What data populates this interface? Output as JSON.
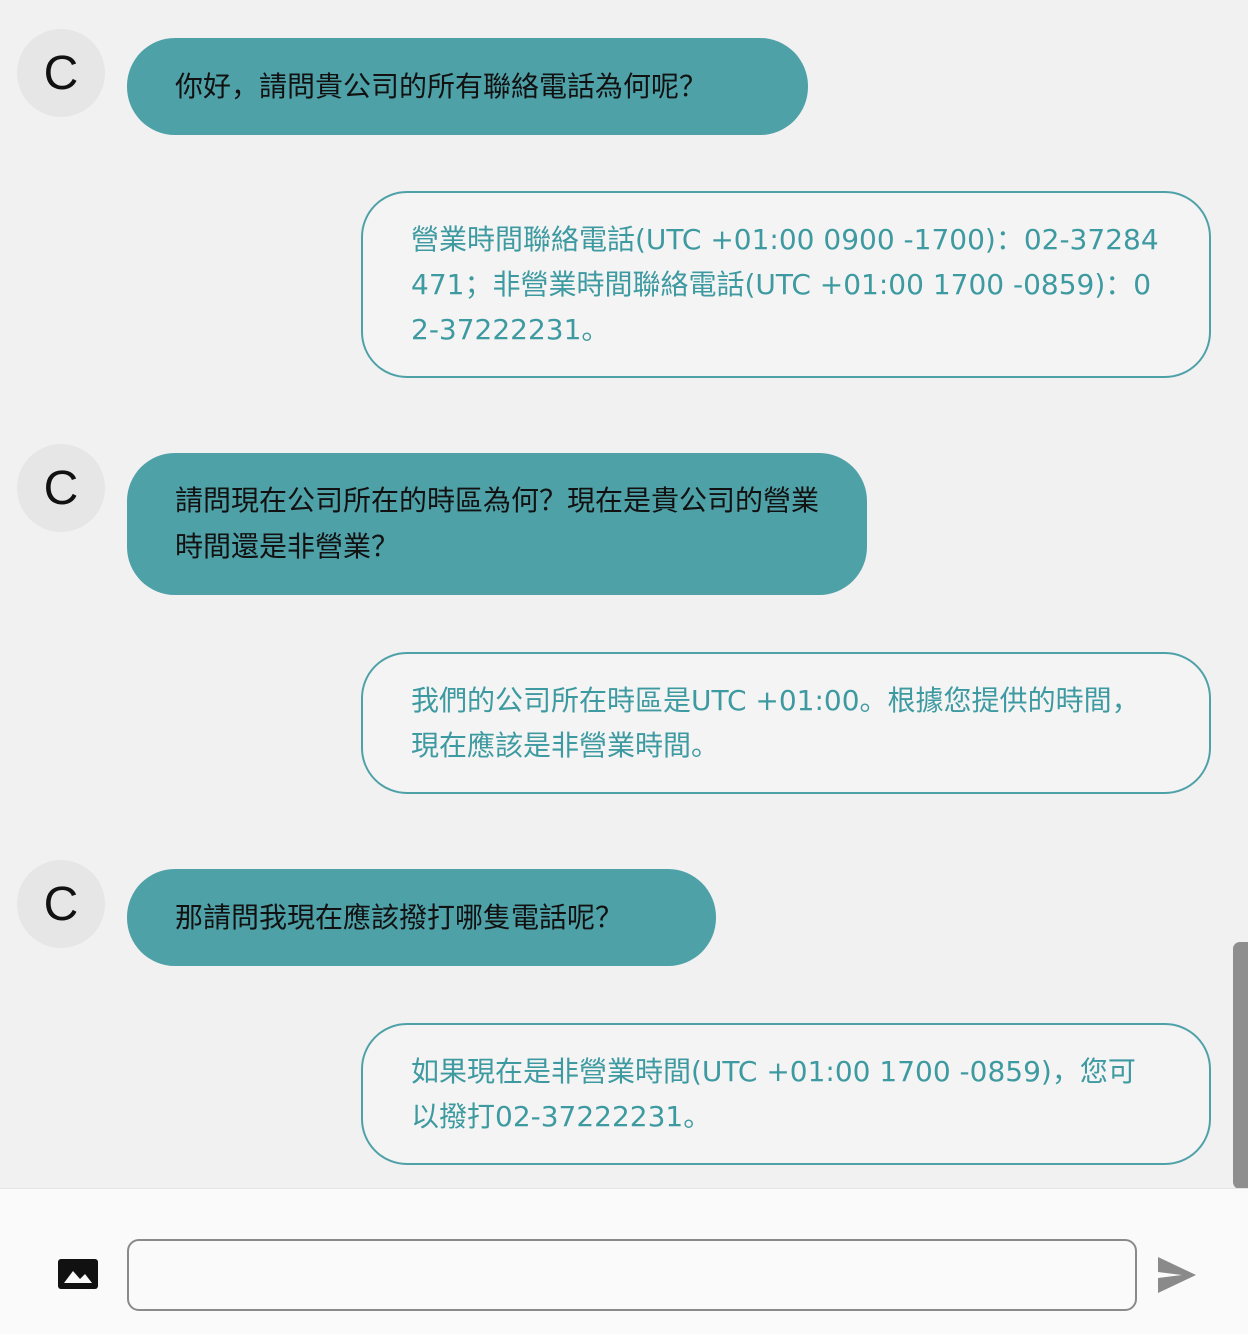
{
  "messages": [
    {
      "role": "user",
      "avatar": "C",
      "text": "你好，請問貴公司的所有聯絡電話為何呢？"
    },
    {
      "role": "bot",
      "text": "營業時間聯絡電話(UTC +01:00 0900 -1700)：02-37284471；非營業時間聯絡電話(UTC +01:00 1700 -0859)：02-37222231。"
    },
    {
      "role": "user",
      "avatar": "C",
      "text": "請問現在公司所在的時區為何？現在是貴公司的營業時間還是非營業？"
    },
    {
      "role": "bot",
      "text": "我們的公司所在時區是UTC +01:00。根據您提供的時間，現在應該是非營業時間。"
    },
    {
      "role": "user",
      "avatar": "C",
      "text": "那請問我現在應該撥打哪隻電話呢？"
    },
    {
      "role": "bot",
      "text": "如果現在是非營業時間(UTC +01:00 1700 -0859)，您可以撥打02-37222231。"
    }
  ],
  "input": {
    "value": "",
    "placeholder": ""
  },
  "icons": {
    "image": "image-icon",
    "send": "send-icon"
  },
  "colors": {
    "user_bubble": "#4fa1a8",
    "bot_text": "#3e9aa1",
    "background": "#f1f1f1"
  }
}
